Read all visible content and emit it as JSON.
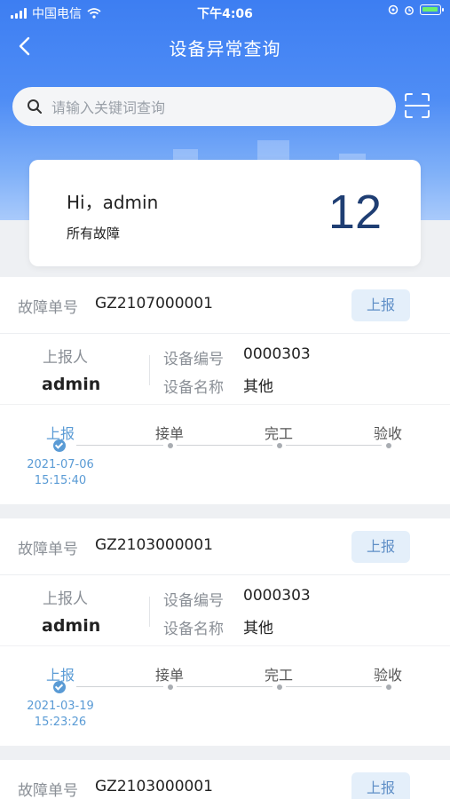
{
  "status_bar": {
    "carrier": "中国电信",
    "time": "下午4:06"
  },
  "nav": {
    "title": "设备异常查询"
  },
  "search": {
    "placeholder": "请输入关键词查询"
  },
  "summary": {
    "greeting": "Hi，admin",
    "label": "所有故障",
    "count": "12"
  },
  "labels": {
    "fault_no": "故障单号",
    "reporter": "上报人",
    "device_code": "设备编号",
    "device_name": "设备名称"
  },
  "orders": [
    {
      "fault_no": "GZ2107000001",
      "status": "上报",
      "reporter": "admin",
      "device_code": "0000303",
      "device_name": "其他",
      "steps": [
        "上报",
        "接单",
        "完工",
        "验收"
      ],
      "date": "2021-07-06",
      "time": "15:15:40"
    },
    {
      "fault_no": "GZ2103000001",
      "status": "上报",
      "reporter": "admin",
      "device_code": "0000303",
      "device_name": "其他",
      "steps": [
        "上报",
        "接单",
        "完工",
        "验收"
      ],
      "date": "2021-03-19",
      "time": "15:23:26"
    },
    {
      "fault_no": "GZ2103000001",
      "status": "上报"
    }
  ],
  "colors": {
    "header": "#4a87f4",
    "accent": "#5a9bd5",
    "count": "#1f3e73"
  }
}
